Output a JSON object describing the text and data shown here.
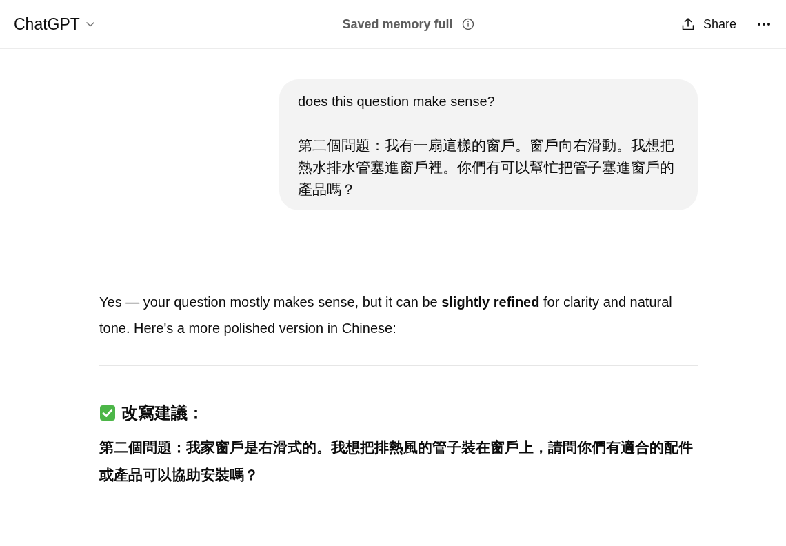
{
  "header": {
    "title": "ChatGPT",
    "status": "Saved memory full",
    "share": "Share"
  },
  "messages": [
    {
      "kind": "user",
      "paragraphs": [
        "does this question make sense?",
        "第二個問題：我有一扇這樣的窗戶。窗戶向右滑動。我想把熱水排水管塞進窗戶裡。你們有可以幫忙把管子塞進窗戶的產品嗎？"
      ]
    },
    {
      "kind": "assistant",
      "blocks": [
        {
          "kind": "paragraph",
          "text": "Yes — your question mostly makes sense, but it can be **slightly refined** for clarity and natural tone. Here's a more polished version in Chinese:"
        },
        {
          "kind": "rule"
        },
        {
          "kind": "heading",
          "text": "改寫建議："
        },
        {
          "kind": "strong",
          "text": "第二個問題：我家窗戶是右滑式的。我想把排熱風的管子裝在窗戶上，請問你們有適合的配件或產品可以協助安裝嗎？"
        },
        {
          "kind": "rule"
        }
      ]
    }
  ]
}
